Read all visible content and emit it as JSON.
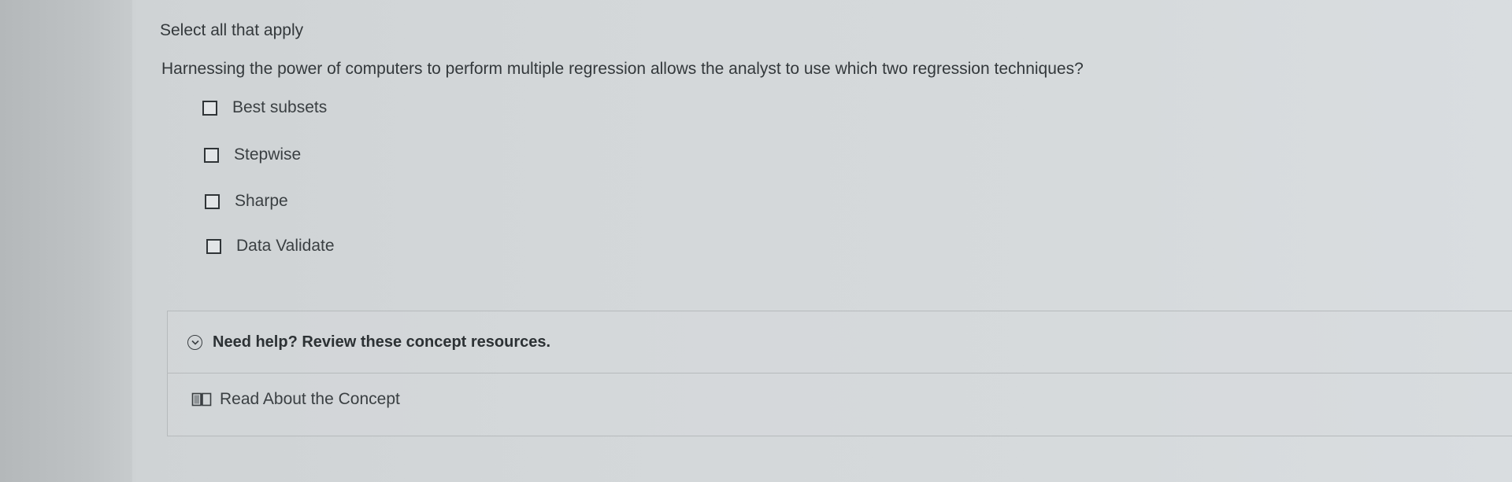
{
  "instruction": "Select all that apply",
  "question": "Harnessing the power of computers to perform multiple regression allows the analyst to use which two regression techniques?",
  "options": [
    {
      "label": "Best subsets",
      "checked": false
    },
    {
      "label": "Stepwise",
      "checked": false
    },
    {
      "label": "Sharpe",
      "checked": false
    },
    {
      "label": "Data Validate",
      "checked": false
    }
  ],
  "help": {
    "title": "Need help? Review these concept resources.",
    "icon": "chevron-down-circle-icon",
    "resources": [
      {
        "label": "Read About the Concept",
        "icon": "book-icon"
      }
    ]
  }
}
